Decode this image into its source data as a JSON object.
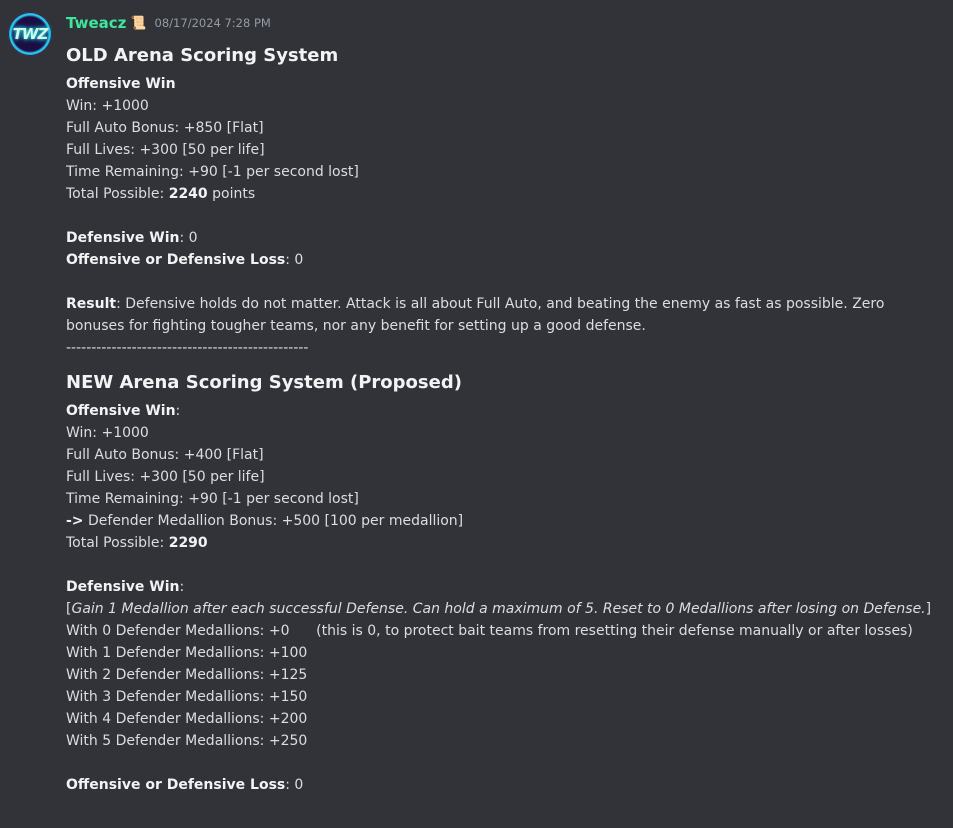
{
  "message": {
    "username": "Tweacz",
    "badge": "📜",
    "timestamp": "08/17/2024 7:28 PM",
    "avatar_text": "TWZ"
  },
  "old_system": {
    "title": "OLD Arena Scoring System",
    "offensive_win_label": "Offensive Win",
    "lines": [
      "Win: +1000",
      "Full Auto Bonus: +850 [Flat]",
      "Full Lives: +300 [50 per life]",
      "Time Remaining: +90 [-1 per second lost]"
    ],
    "total_prefix": "Total Possible: ",
    "total_value": "2240",
    "total_suffix": " points",
    "defensive_win_label": "Defensive Win",
    "defensive_win_value": ": 0",
    "loss_label": "Offensive or Defensive Loss",
    "loss_value": ": 0",
    "result_label": "Result",
    "result_text": ": Defensive holds do not matter. Attack is all about Full Auto, and beating the enemy as fast as possible. Zero bonuses for fighting tougher teams, nor any benefit for setting up a good defense.",
    "divider": "------------------------------------------------"
  },
  "new_system": {
    "title": "NEW Arena Scoring System (Proposed)",
    "offensive_win_label": "Offensive Win",
    "offensive_win_colon": ":",
    "lines": [
      "Win: +1000",
      "Full Auto Bonus: +400 [Flat]",
      "Full Lives: +300 [50 per life]",
      "Time Remaining: +90 [-1 per second lost]"
    ],
    "arrow": "->",
    "medallion_bonus": " Defender Medallion Bonus: +500 [100 per medallion]",
    "total_prefix": "Total Possible: ",
    "total_value": "2290",
    "defensive_win_label": "Defensive Win",
    "defensive_win_colon": ":",
    "bracket_open": "[",
    "medallion_rule": "Gain 1 Medallion after each successful Defense. Can hold a maximum of 5. Reset to 0 Medallions after losing on Defense.",
    "bracket_close": "]",
    "medallions": [
      "With 0 Defender Medallions: +0      (this is 0, to protect bait teams from resetting their defense manually or after losses)",
      "With 1 Defender Medallions: +100",
      "With 2 Defender Medallions: +125",
      "With 3 Defender Medallions: +150",
      "With 4 Defender Medallions: +200",
      "With 5 Defender Medallions: +250"
    ],
    "loss_label": "Offensive or Defensive Loss",
    "loss_value": ": 0"
  }
}
